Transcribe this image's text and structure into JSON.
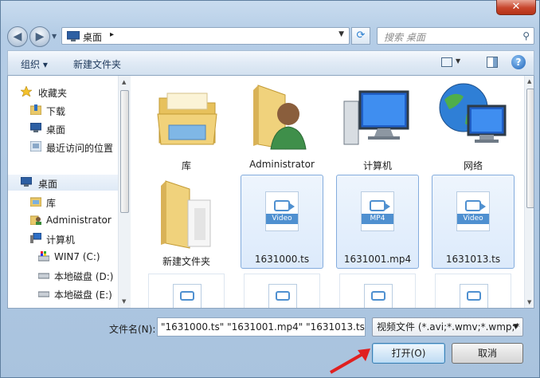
{
  "window": {
    "close_label": "✕"
  },
  "address": {
    "location": "桌面",
    "crumb_arrow": "▸"
  },
  "search": {
    "placeholder": "搜索 桌面"
  },
  "toolbar": {
    "organize_label": "组织 ▾",
    "new_folder_label": "新建文件夹"
  },
  "sidebar": {
    "items": [
      {
        "label": "收藏夹",
        "icon": "star-icon"
      },
      {
        "label": "下载",
        "icon": "download-folder-icon"
      },
      {
        "label": "桌面",
        "icon": "desktop-icon"
      },
      {
        "label": "最近访问的位置",
        "icon": "recent-places-icon"
      },
      {
        "label": "桌面",
        "icon": "desktop-icon"
      },
      {
        "label": "库",
        "icon": "library-icon"
      },
      {
        "label": "Administrator",
        "icon": "user-folder-icon"
      },
      {
        "label": "计算机",
        "icon": "computer-icon"
      },
      {
        "label": "WIN7 (C:)",
        "icon": "system-drive-icon"
      },
      {
        "label": "本地磁盘 (D:)",
        "icon": "drive-icon"
      },
      {
        "label": "本地磁盘 (E:)",
        "icon": "drive-icon"
      }
    ]
  },
  "files": [
    {
      "name": "库",
      "type": "library"
    },
    {
      "name": "Administrator",
      "type": "user"
    },
    {
      "name": "计算机",
      "type": "computer"
    },
    {
      "name": "网络",
      "type": "network"
    },
    {
      "name": "新建文件夹",
      "type": "folder"
    },
    {
      "name": "1631000.ts",
      "type": "video",
      "badge": "Video"
    },
    {
      "name": "1631001.mp4",
      "type": "video",
      "badge": "MP4"
    },
    {
      "name": "1631013.ts",
      "type": "video",
      "badge": "Video"
    }
  ],
  "filename": {
    "label": "文件名(N):",
    "value": "\"1631000.ts\" \"1631001.mp4\" \"1631013.ts"
  },
  "filetype": {
    "selected": "视频文件 (*.avi;*.wmv;*.wmp;*"
  },
  "buttons": {
    "open": "打开(O)",
    "cancel": "取消"
  },
  "colors": {
    "selection": "#dceafb",
    "accent": "#4f90d0",
    "arrow": "#e02020"
  }
}
